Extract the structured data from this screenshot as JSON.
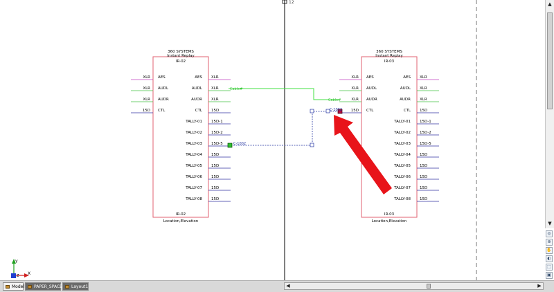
{
  "crosshair_label": "12",
  "left_block": {
    "title_line1": "360 SYSTEMS",
    "title_line2": "Instant Replay",
    "tag_top": "IR-02",
    "tag_bottom": "IR-02",
    "location": "Location,Elevation",
    "left_pins": [
      {
        "type": "XLR",
        "label": "AES"
      },
      {
        "type": "XLR",
        "label": "AUDL"
      },
      {
        "type": "XLR",
        "label": "AUDR"
      },
      {
        "type": "15D",
        "label": "CTL"
      }
    ],
    "right_pins": [
      {
        "label": "AES",
        "type": "XLR"
      },
      {
        "label": "AUDL",
        "type": "XLR"
      },
      {
        "label": "AUDR",
        "type": "XLR"
      },
      {
        "label": "CTL",
        "type": "15D"
      },
      {
        "label": "TALLY-01",
        "type": "15D-1"
      },
      {
        "label": "TALLY-02",
        "type": "15D-2"
      },
      {
        "label": "TALLY-03",
        "type": "15D-5"
      },
      {
        "label": "TALLY-04",
        "type": "15D"
      },
      {
        "label": "TALLY-05",
        "type": "15D"
      },
      {
        "label": "TALLY-06",
        "type": "15D"
      },
      {
        "label": "TALLY-07",
        "type": "15D"
      },
      {
        "label": "TALLY-08",
        "type": "15D"
      }
    ]
  },
  "right_block": {
    "title_line1": "360 SYSTEMS",
    "title_line2": "Instant Replay",
    "tag_top": "IR-03",
    "tag_bottom": "IR-03",
    "location": "Location,Elevation",
    "left_pins": [
      {
        "type": "XLR",
        "label": "AES"
      },
      {
        "type": "XLR",
        "label": "AUDL"
      },
      {
        "type": "XLR",
        "label": "AUDR"
      },
      {
        "type": "15D",
        "label": "CTL"
      }
    ],
    "right_pins": [
      {
        "label": "AES",
        "type": "XLR"
      },
      {
        "label": "AUDL",
        "type": "XLR"
      },
      {
        "label": "AUDR",
        "type": "XLR"
      },
      {
        "label": "CTL",
        "type": "15D"
      },
      {
        "label": "TALLY-01",
        "type": "15D-1"
      },
      {
        "label": "TALLY-02",
        "type": "15D-2"
      },
      {
        "label": "TALLY-03",
        "type": "15D-5"
      },
      {
        "label": "TALLY-04",
        "type": "15D"
      },
      {
        "label": "TALLY-05",
        "type": "15D"
      },
      {
        "label": "TALLY-06",
        "type": "15D"
      },
      {
        "label": "TALLY-07",
        "type": "15D"
      },
      {
        "label": "TALLY-08",
        "type": "15D"
      }
    ]
  },
  "wire_labels": {
    "cable_a": "Cable#",
    "cable_b": "Cable#",
    "c1002_a": "C-1002",
    "c1002_b": "C-1002"
  },
  "ucs": {
    "x": "X",
    "y": "Y",
    "z": "Z"
  },
  "tabs": {
    "model": "Model",
    "paper_space": "PAPER_SPACE",
    "layout1": "Layout1"
  },
  "colors": {
    "block_border": "#e06070",
    "xlr_wire": "#c040c0",
    "audio_wire": "#40c040",
    "data_wire": "#3030a0",
    "cable_green": "#40e040",
    "arrow": "#e8141a"
  }
}
